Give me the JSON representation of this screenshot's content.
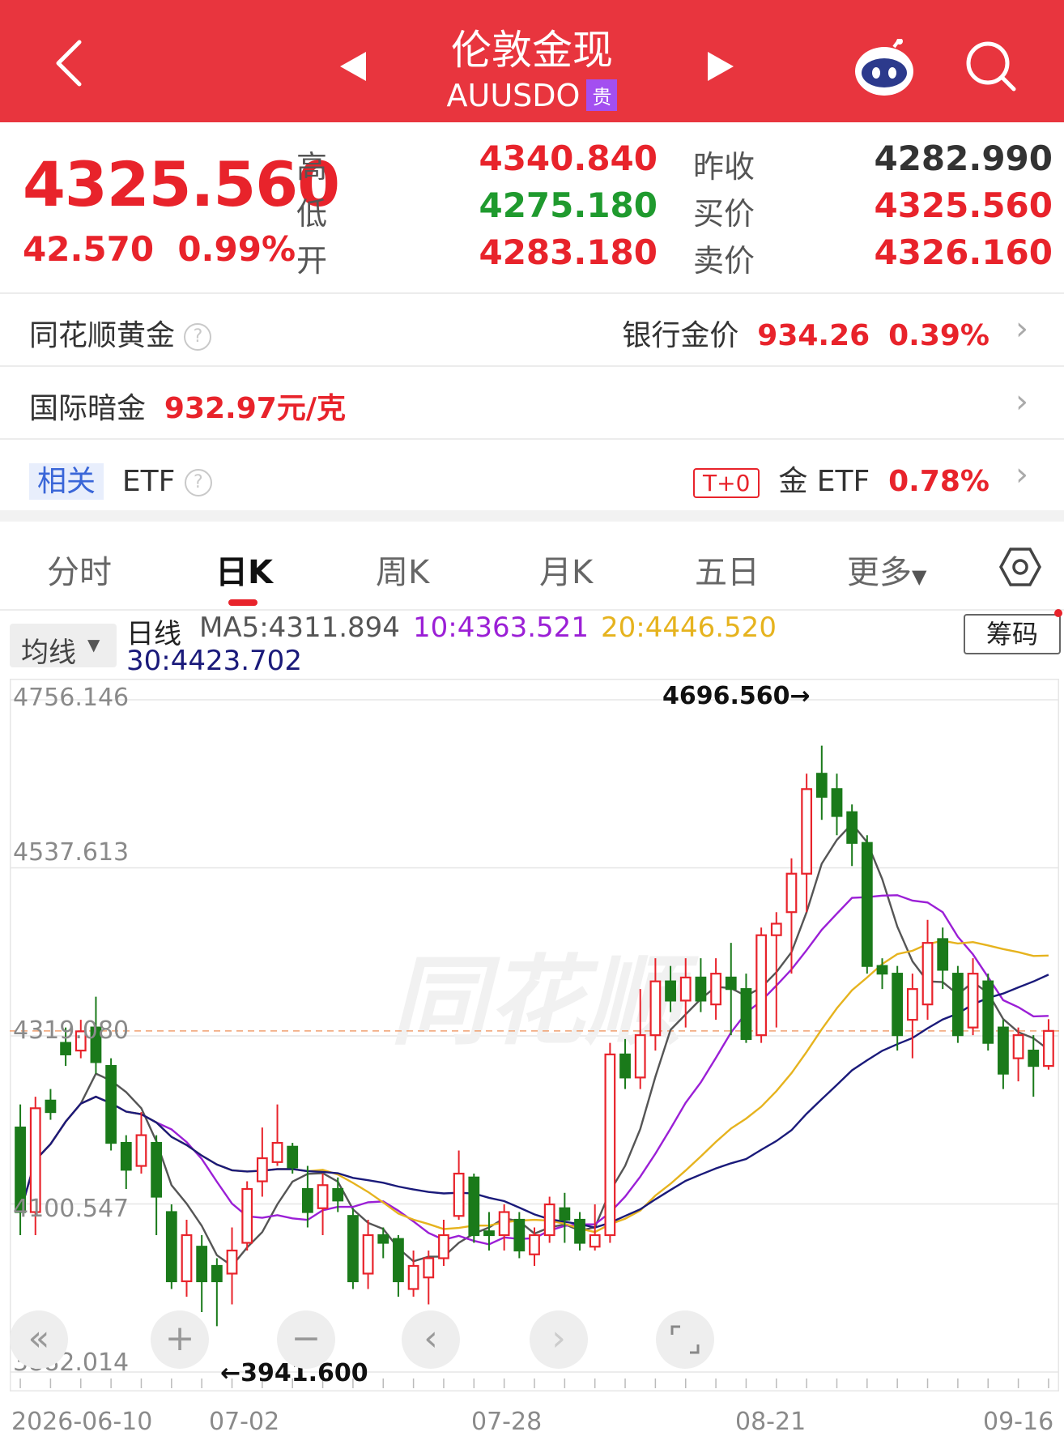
{
  "header": {
    "title": "伦敦金现",
    "code": "AUUSDO",
    "badge": "贵",
    "bg": "#e8353e"
  },
  "quote": {
    "price": "4325.560",
    "change": "42.570",
    "change_pct": "0.99%",
    "high_label": "高",
    "high": "4340.840",
    "low_label": "低",
    "low": "4275.180",
    "open_label": "开",
    "open": "4283.180",
    "prev_close_label": "昨收",
    "prev_close": "4282.990",
    "bid_label": "买价",
    "bid": "4325.560",
    "ask_label": "卖价",
    "ask": "4326.160"
  },
  "rows": {
    "ths_gold": "同花顺黄金",
    "bank_gold_label": "银行金价",
    "bank_gold_price": "934.26",
    "bank_gold_pct": "0.39%",
    "intl_label": "国际暗金",
    "intl_value": "932.97元/克",
    "related": "相关",
    "etf": "ETF",
    "t0": "T+0",
    "gold_etf": "金 ETF",
    "gold_etf_pct": "0.78%"
  },
  "tabs": [
    "分时",
    "日K",
    "周K",
    "月K",
    "五日",
    "更多"
  ],
  "active_tab": "日K",
  "ma": {
    "selector": "均线",
    "line": "日线",
    "ma5": "MA5:4311.894",
    "ma10": "10:4363.521",
    "ma20": "20:4446.520",
    "ma30": "30:4423.702",
    "chips_button": "筹码",
    "colors": {
      "ma5": "#555555",
      "ma10": "#9b1fd6",
      "ma20": "#e6b31e",
      "ma30": "#1a1a7a"
    }
  },
  "chart_data": {
    "type": "candlestick",
    "y_ticks": [
      "4756.146",
      "4537.613",
      "4319.080",
      "4100.547",
      "3882.014"
    ],
    "x_ticks": [
      "2026-06-10",
      "07-02",
      "07-28",
      "08-21",
      "09-16"
    ],
    "max_label": "4696.560→",
    "min_label": "←3941.600",
    "ylim": [
      3882.014,
      4756.146
    ],
    "current_price": 4325.56,
    "up_color": "#e8232b",
    "down_color": "#1a7a1a",
    "candles": [
      [
        4200,
        4090,
        4230,
        4060
      ],
      [
        4090,
        4225,
        4240,
        4060
      ],
      [
        4235,
        4220,
        4250,
        4210
      ],
      [
        4310,
        4295,
        4330,
        4280
      ],
      [
        4300,
        4325,
        4340,
        4290
      ],
      [
        4330,
        4285,
        4370,
        4270
      ],
      [
        4280,
        4180,
        4290,
        4170
      ],
      [
        4180,
        4145,
        4190,
        4120
      ],
      [
        4150,
        4190,
        4220,
        4140
      ],
      [
        4180,
        4110,
        4190,
        4060
      ],
      [
        4090,
        4000,
        4100,
        3990
      ],
      [
        4000,
        4060,
        4080,
        3980
      ],
      [
        4045,
        4000,
        4060,
        3960
      ],
      [
        4020,
        4000,
        4030,
        3941.6
      ],
      [
        4010,
        4040,
        4070,
        3970
      ],
      [
        4050,
        4120,
        4130,
        4040
      ],
      [
        4130,
        4160,
        4200,
        4110
      ],
      [
        4155,
        4180,
        4230,
        4150
      ],
      [
        4175,
        4148,
        4180,
        4140
      ],
      [
        4120,
        4090,
        4150,
        4070
      ],
      [
        4095,
        4125,
        4140,
        4060
      ],
      [
        4120,
        4105,
        4135,
        4090
      ],
      [
        4085,
        4000,
        4095,
        3990
      ],
      [
        4010,
        4060,
        4080,
        3990
      ],
      [
        4060,
        4050,
        4070,
        4030
      ],
      [
        4055,
        4000,
        4060,
        3980
      ],
      [
        3990,
        4020,
        4040,
        3980
      ],
      [
        4005,
        4030,
        4040,
        3970
      ],
      [
        4030,
        4060,
        4080,
        4020
      ],
      [
        4085,
        4140,
        4170,
        4080
      ],
      [
        4135,
        4060,
        4140,
        4050
      ],
      [
        4065,
        4060,
        4090,
        4040
      ],
      [
        4060,
        4090,
        4100,
        4040
      ],
      [
        4080,
        4040,
        4090,
        4030
      ],
      [
        4035,
        4060,
        4070,
        4020
      ],
      [
        4060,
        4100,
        4110,
        4050
      ],
      [
        4095,
        4080,
        4115,
        4050
      ],
      [
        4080,
        4050,
        4090,
        4040
      ],
      [
        4045,
        4060,
        4100,
        4040
      ],
      [
        4060,
        4295,
        4310,
        4050
      ],
      [
        4295,
        4265,
        4315,
        4250
      ],
      [
        4265,
        4320,
        4380,
        4250
      ],
      [
        4320,
        4390,
        4420,
        4300
      ],
      [
        4390,
        4365,
        4410,
        4350
      ],
      [
        4365,
        4395,
        4420,
        4330
      ],
      [
        4395,
        4365,
        4420,
        4350
      ],
      [
        4360,
        4400,
        4420,
        4340
      ],
      [
        4395,
        4380,
        4440,
        4320
      ],
      [
        4380,
        4315,
        4400,
        4310
      ],
      [
        4320,
        4450,
        4460,
        4310
      ],
      [
        4450,
        4465,
        4480,
        4330
      ],
      [
        4480,
        4530,
        4550,
        4400
      ],
      [
        4530,
        4640,
        4660,
        4480
      ],
      [
        4660,
        4630,
        4696.56,
        4600
      ],
      [
        4640,
        4605,
        4660,
        4580
      ],
      [
        4610,
        4570,
        4620,
        4540
      ],
      [
        4570,
        4410,
        4580,
        4400
      ],
      [
        4410,
        4400,
        4420,
        4380
      ],
      [
        4400,
        4320,
        4410,
        4300
      ],
      [
        4340,
        4380,
        4400,
        4290
      ],
      [
        4360,
        4440,
        4470,
        4340
      ],
      [
        4445,
        4405,
        4460,
        4380
      ],
      [
        4400,
        4320,
        4410,
        4310
      ],
      [
        4330,
        4400,
        4420,
        4320
      ],
      [
        4390,
        4310,
        4400,
        4300
      ],
      [
        4330,
        4270,
        4340,
        4250
      ],
      [
        4290,
        4320,
        4330,
        4260
      ],
      [
        4300,
        4280,
        4320,
        4240
      ],
      [
        4280,
        4325.56,
        4340.84,
        4275.18
      ]
    ]
  }
}
